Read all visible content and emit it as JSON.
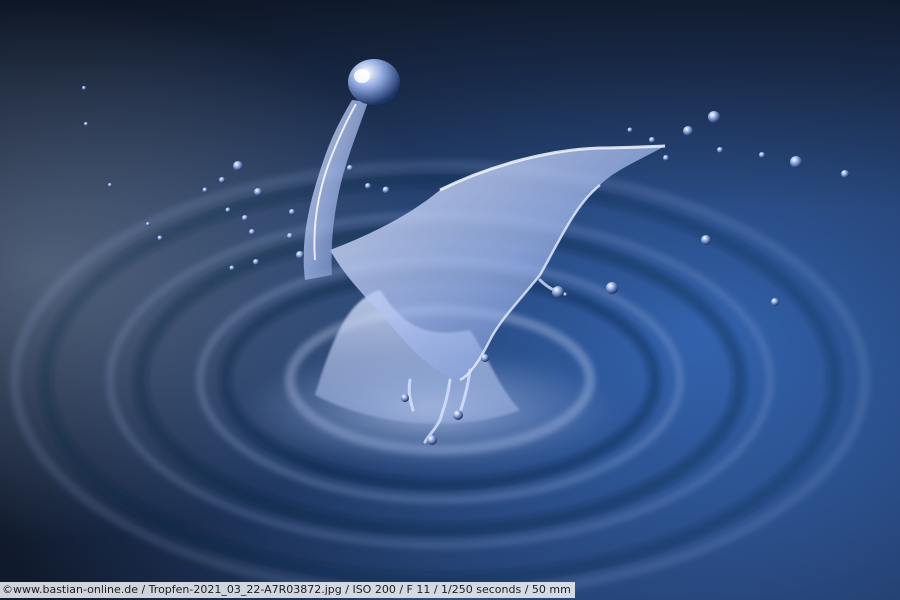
{
  "photo": {
    "subject": "water-drop-splash",
    "colors": {
      "background_dark": "#0f1a2c",
      "background_mid": "#2a4a7e",
      "background_light": "#3c78d6",
      "water_highlight": "#dde8ff",
      "water_body": "#9fb6e8"
    }
  },
  "caption": {
    "text": "©www.bastian-online.de / Tropfen-2021_03_22-A7R03872.jpg / ISO 200 / F 11 / 1/250 seconds  / 50 mm"
  }
}
